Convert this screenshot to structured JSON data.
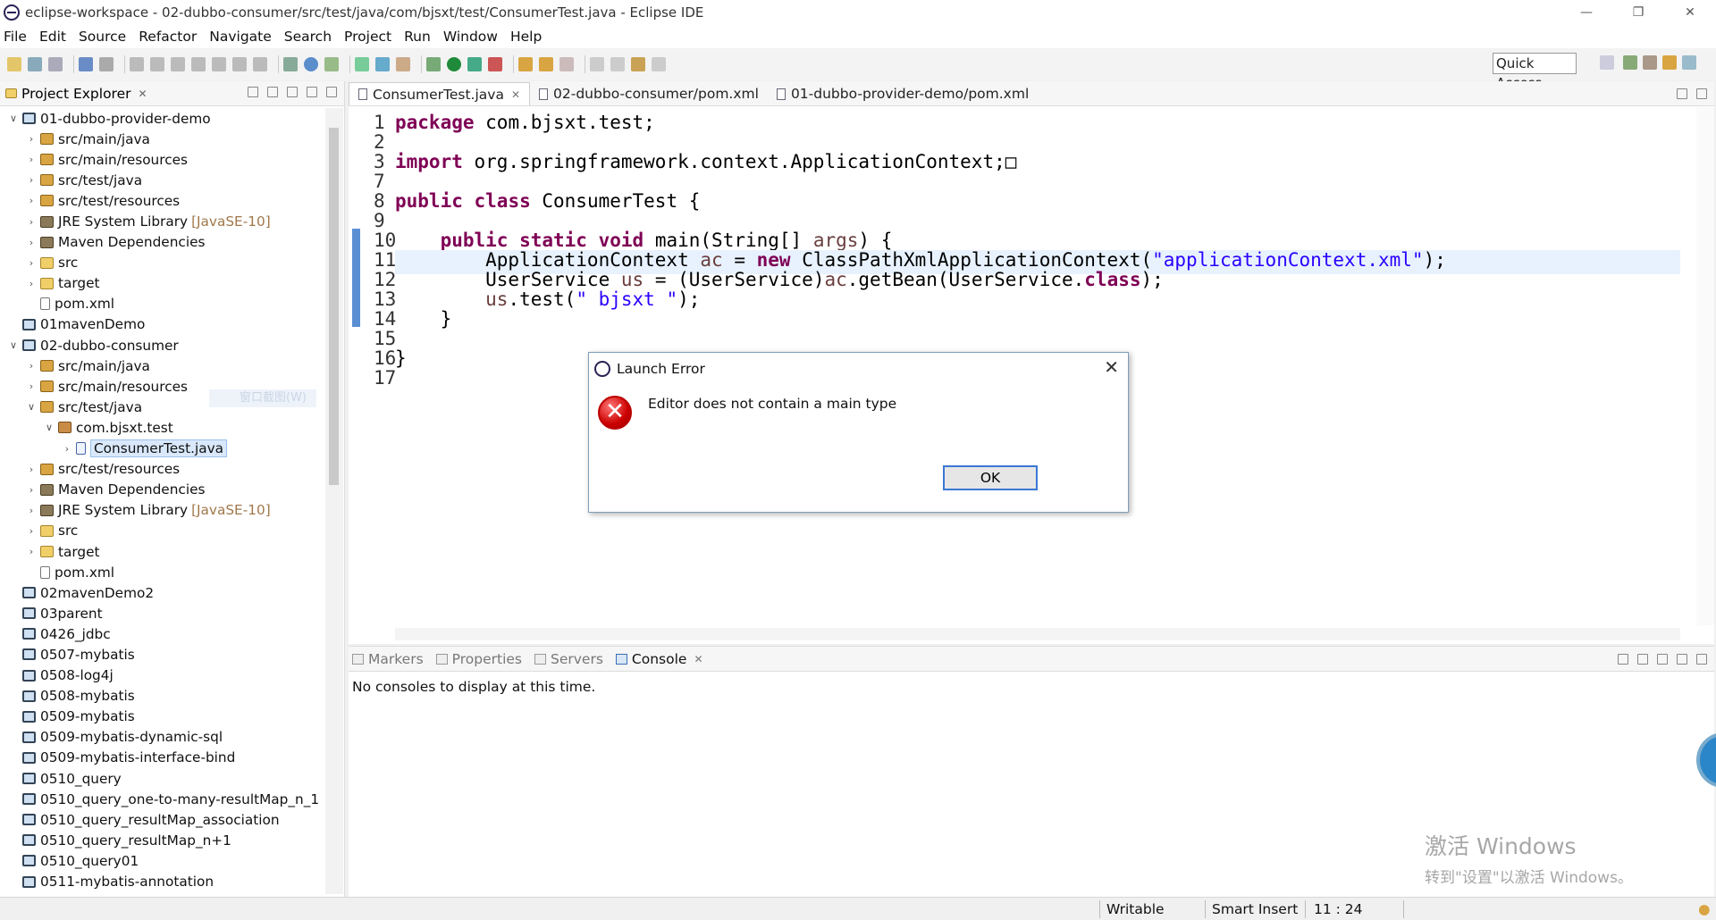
{
  "window": {
    "title": "eclipse-workspace - 02-dubbo-consumer/src/test/java/com/bjsxt/test/ConsumerTest.java - Eclipse IDE"
  },
  "menu": [
    "File",
    "Edit",
    "Source",
    "Refactor",
    "Navigate",
    "Search",
    "Project",
    "Run",
    "Window",
    "Help"
  ],
  "toolbar": {
    "quick_access": "Quick Access"
  },
  "explorer": {
    "title": "Project Explorer",
    "items": [
      {
        "label": "01-dubbo-provider-demo",
        "suffix": "",
        "indent": 0,
        "twisty": "v",
        "icon": "proj"
      },
      {
        "label": "src/main/java",
        "suffix": "",
        "indent": 1,
        "twisty": ">",
        "icon": "src"
      },
      {
        "label": "src/main/resources",
        "suffix": "",
        "indent": 1,
        "twisty": ">",
        "icon": "src"
      },
      {
        "label": "src/test/java",
        "suffix": "",
        "indent": 1,
        "twisty": ">",
        "icon": "src"
      },
      {
        "label": "src/test/resources",
        "suffix": "",
        "indent": 1,
        "twisty": ">",
        "icon": "src"
      },
      {
        "label": "JRE System Library",
        "suffix": "[JavaSE-10]",
        "indent": 1,
        "twisty": ">",
        "icon": "lib"
      },
      {
        "label": "Maven Dependencies",
        "suffix": "",
        "indent": 1,
        "twisty": ">",
        "icon": "lib"
      },
      {
        "label": "src",
        "suffix": "",
        "indent": 1,
        "twisty": ">",
        "icon": "fold"
      },
      {
        "label": "target",
        "suffix": "",
        "indent": 1,
        "twisty": ">",
        "icon": "fold"
      },
      {
        "label": "pom.xml",
        "suffix": "",
        "indent": 1,
        "twisty": "",
        "icon": "file"
      },
      {
        "label": "01mavenDemo",
        "suffix": "",
        "indent": 0,
        "twisty": "",
        "icon": "proj"
      },
      {
        "label": "02-dubbo-consumer",
        "suffix": "",
        "indent": 0,
        "twisty": "v",
        "icon": "proj"
      },
      {
        "label": "src/main/java",
        "suffix": "",
        "indent": 1,
        "twisty": ">",
        "icon": "src"
      },
      {
        "label": "src/main/resources",
        "suffix": "",
        "indent": 1,
        "twisty": ">",
        "icon": "src"
      },
      {
        "label": "src/test/java",
        "suffix": "",
        "indent": 1,
        "twisty": "v",
        "icon": "src"
      },
      {
        "label": "com.bjsxt.test",
        "suffix": "",
        "indent": 2,
        "twisty": "v",
        "icon": "pkg"
      },
      {
        "label": "ConsumerTest.java",
        "suffix": "",
        "indent": 3,
        "twisty": ">",
        "icon": "java",
        "selected": true
      },
      {
        "label": "src/test/resources",
        "suffix": "",
        "indent": 1,
        "twisty": ">",
        "icon": "src"
      },
      {
        "label": "Maven Dependencies",
        "suffix": "",
        "indent": 1,
        "twisty": ">",
        "icon": "lib"
      },
      {
        "label": "JRE System Library",
        "suffix": "[JavaSE-10]",
        "indent": 1,
        "twisty": ">",
        "icon": "lib"
      },
      {
        "label": "src",
        "suffix": "",
        "indent": 1,
        "twisty": ">",
        "icon": "fold"
      },
      {
        "label": "target",
        "suffix": "",
        "indent": 1,
        "twisty": ">",
        "icon": "fold"
      },
      {
        "label": "pom.xml",
        "suffix": "",
        "indent": 1,
        "twisty": "",
        "icon": "file"
      },
      {
        "label": "02mavenDemo2",
        "suffix": "",
        "indent": 0,
        "twisty": "",
        "icon": "proj"
      },
      {
        "label": "03parent",
        "suffix": "",
        "indent": 0,
        "twisty": "",
        "icon": "proj"
      },
      {
        "label": "0426_jdbc",
        "suffix": "",
        "indent": 0,
        "twisty": "",
        "icon": "proj"
      },
      {
        "label": "0507-mybatis",
        "suffix": "",
        "indent": 0,
        "twisty": "",
        "icon": "proj"
      },
      {
        "label": "0508-log4j",
        "suffix": "",
        "indent": 0,
        "twisty": "",
        "icon": "proj"
      },
      {
        "label": "0508-mybatis",
        "suffix": "",
        "indent": 0,
        "twisty": "",
        "icon": "proj"
      },
      {
        "label": "0509-mybatis",
        "suffix": "",
        "indent": 0,
        "twisty": "",
        "icon": "proj"
      },
      {
        "label": "0509-mybatis-dynamic-sql",
        "suffix": "",
        "indent": 0,
        "twisty": "",
        "icon": "proj"
      },
      {
        "label": "0509-mybatis-interface-bind",
        "suffix": "",
        "indent": 0,
        "twisty": "",
        "icon": "proj"
      },
      {
        "label": "0510_query",
        "suffix": "",
        "indent": 0,
        "twisty": "",
        "icon": "proj"
      },
      {
        "label": "0510_query_one-to-many-resultMap_n_1",
        "suffix": "",
        "indent": 0,
        "twisty": "",
        "icon": "proj"
      },
      {
        "label": "0510_query_resultMap_association",
        "suffix": "",
        "indent": 0,
        "twisty": "",
        "icon": "proj"
      },
      {
        "label": "0510_query_resultMap_n+1",
        "suffix": "",
        "indent": 0,
        "twisty": "",
        "icon": "proj"
      },
      {
        "label": "0510_query01",
        "suffix": "",
        "indent": 0,
        "twisty": "",
        "icon": "proj"
      },
      {
        "label": "0511-mybatis-annotation",
        "suffix": "",
        "indent": 0,
        "twisty": "",
        "icon": "proj"
      }
    ],
    "overlay_text": "窗口截图(W)"
  },
  "editor": {
    "tabs": [
      "ConsumerTest.java",
      "02-dubbo-consumer/pom.xml",
      "01-dubbo-provider-demo/pom.xml"
    ],
    "lines": [
      {
        "num": "1",
        "html": "<span class=\"kw\">package</span> com.bjsxt.test;"
      },
      {
        "num": "2",
        "html": ""
      },
      {
        "num": "3",
        "html": "<span class=\"kw\">import</span> org.springframework.context.ApplicationContext;&#9633;"
      },
      {
        "num": "7",
        "html": ""
      },
      {
        "num": "8",
        "html": "<span class=\"kw\">public</span> <span class=\"kw\">class</span> ConsumerTest {"
      },
      {
        "num": "9",
        "html": ""
      },
      {
        "num": "10",
        "html": "    <span class=\"kw\">public</span> <span class=\"kw\">static</span> <span class=\"kw\">void</span> main(String[] <span class=\"fld\">args</span>) {"
      },
      {
        "num": "11",
        "html": "        ApplicationContext <span class=\"fld\">ac</span> = <span class=\"kw\">new</span> ClassPathXmlApplicationContext(<span class=\"str\">\"applicationContext.xml\"</span>);"
      },
      {
        "num": "12",
        "html": "        UserService <span class=\"fld\">us</span> = (UserService)<span class=\"fld\">ac</span>.getBean(UserService.<span class=\"kw\">class</span>);"
      },
      {
        "num": "13",
        "html": "        <span class=\"fld\">us</span>.test(<span class=\"str\">\" bjsxt \"</span>);"
      },
      {
        "num": "14",
        "html": "    }"
      },
      {
        "num": "15",
        "html": ""
      },
      {
        "num": "16",
        "html": "}"
      },
      {
        "num": "17",
        "html": ""
      }
    ]
  },
  "console": {
    "tabs": [
      "Markers",
      "Properties",
      "Servers",
      "Console"
    ],
    "message": "No consoles to display at this time."
  },
  "dialog": {
    "title": "Launch Error",
    "message": "Editor does not contain a main type",
    "ok": "OK"
  },
  "status": {
    "writable": "Writable",
    "insert": "Smart Insert",
    "position": "11 : 24"
  },
  "watermark": {
    "line1": "激活 Windows",
    "line2": "转到\"设置\"以激活 Windows。"
  },
  "colors": {
    "keyword": "#7f0055",
    "string": "#2a00ff",
    "selection": "#d9e8fb"
  }
}
